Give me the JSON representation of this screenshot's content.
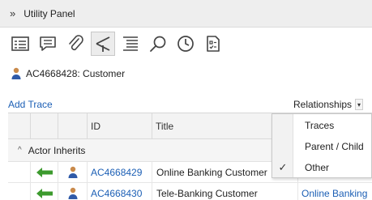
{
  "header": {
    "chevron": "»",
    "title": "Utility Panel"
  },
  "toolbar": {
    "buttons": [
      {
        "icon": "details-icon"
      },
      {
        "icon": "comments-icon"
      },
      {
        "icon": "attachment-icon"
      },
      {
        "icon": "traces-icon",
        "active": true
      },
      {
        "icon": "outline-icon"
      },
      {
        "icon": "search-icon"
      },
      {
        "icon": "history-icon"
      },
      {
        "icon": "checklist-icon"
      }
    ]
  },
  "entity": {
    "icon": "actor-icon",
    "label": "AC4668428: Customer"
  },
  "actions": {
    "add_trace": "Add Trace",
    "relationships": "Relationships"
  },
  "grid": {
    "columns": [
      "ID",
      "Title"
    ],
    "group": {
      "arrow": "^",
      "label": "Actor Inherits"
    },
    "rows": [
      {
        "id": "AC4668429",
        "title": "Online Banking Customer",
        "related": ""
      },
      {
        "id": "AC4668430",
        "title": "Tele-Banking Customer",
        "related": "Online Banking"
      }
    ]
  },
  "dropdown": {
    "items": [
      {
        "label": "Traces",
        "checked": false
      },
      {
        "label": "Parent / Child",
        "checked": false
      },
      {
        "label": "Other",
        "checked": true
      }
    ],
    "check_glyph": "✓"
  },
  "colors": {
    "link": "#1c5fb5",
    "arrow_green": "#3c9a2e",
    "header_bg": "#eeeeee"
  }
}
